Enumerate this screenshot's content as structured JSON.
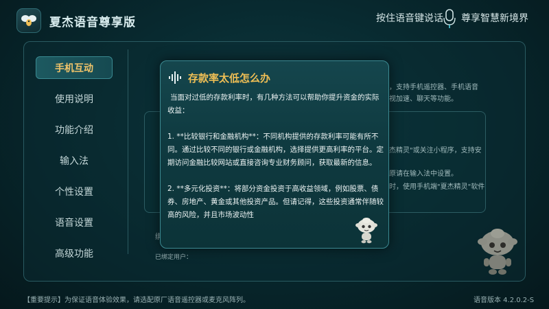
{
  "header": {
    "app_title": "夏杰语音尊享版",
    "hint": "按住语音键说话",
    "slogan": "尊享智慧新境界"
  },
  "sidebar": {
    "items": [
      {
        "label": "手机互动",
        "active": true
      },
      {
        "label": "使用说明",
        "active": false
      },
      {
        "label": "功能介绍",
        "active": false
      },
      {
        "label": "输入法",
        "active": false
      },
      {
        "label": "个性设置",
        "active": false
      },
      {
        "label": "语音设置",
        "active": false
      },
      {
        "label": "高级功能",
        "active": false
      }
    ]
  },
  "background": {
    "line1": "，支持手机遥控器、手机语音",
    "line2": "视加速、聊天等功能。",
    "line3": "杰精灵\"或关注小程序，支持安",
    "line4": "原请在输入法中设置。",
    "line5": "时，使用手机端\"夏杰精灵\"软件",
    "cut_label": "绑",
    "bound_user": "已绑定用户："
  },
  "modal": {
    "title": "存款率太低怎么办",
    "paragraphs": [
      "当面对过低的存款利率时，有几种方法可以帮助你提升资金的实际收益：",
      "1. **比较银行和金融机构**：不同机构提供的存款利率可能有所不同。通过比较不同的银行或金融机构，选择提供更高利率的平台。定期访问金融比较网站或直接咨询专业财务顾问，获取最新的信息。",
      "2. **多元化投资**：将部分资金投资于高收益领域，例如股票、债券、房地产、黄金或其他投资产品。但请记得，这些投资通常伴随较高的风险，并且市场波动性"
    ]
  },
  "footer": {
    "tip": "【重要提示】为保证语音体验效果，请选配原厂语音遥控器或麦克风阵列。",
    "version": "语音版本 4.2.0.2-S"
  },
  "colors": {
    "accent": "#f0bf55",
    "panel_border": "#2a5b62",
    "background": "#082a30"
  },
  "icons": {
    "logo": "bee-logo-icon",
    "mic": "microphone-icon",
    "wave": "sound-wave-icon",
    "mascot": "robot-mascot-icon"
  }
}
